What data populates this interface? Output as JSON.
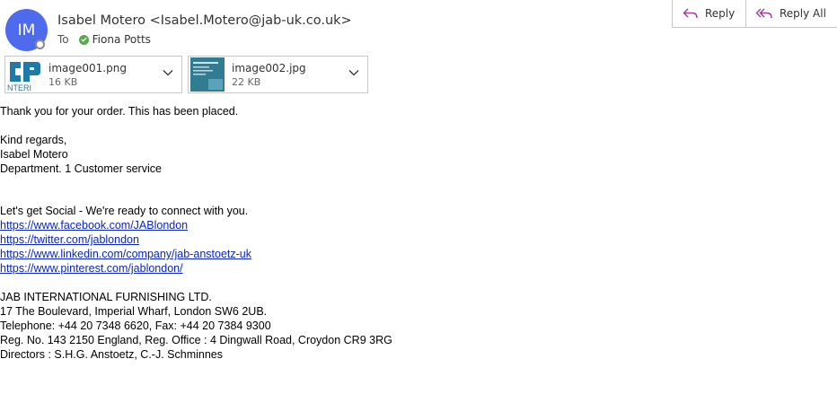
{
  "header": {
    "avatar_initials": "IM",
    "sender": "Isabel Motero <Isabel.Motero@jab-uk.co.uk>",
    "to_label": "To",
    "recipient": "Fiona Potts"
  },
  "actions": {
    "reply": "Reply",
    "reply_all": "Reply All"
  },
  "attachments": [
    {
      "name": "image001.png",
      "size": "16 KB",
      "thumb_text": "NTERI"
    },
    {
      "name": "image002.jpg",
      "size": "22 KB"
    }
  ],
  "message": {
    "line1": "Thank you for your order. This has been placed.",
    "regards": "Kind regards,",
    "name": "Isabel Motero",
    "dept": "Department. 1 Customer service",
    "social": "Let's get Social - We're ready to connect with you.",
    "links": [
      "https://www.facebook.com/JABlondon",
      "https://twitter.com/jablondon",
      "https://www.linkedin.com/company/jab-anstoetz-uk",
      "https://www.pinterest.com/jablondon/"
    ],
    "company": "JAB INTERNATIONAL FURNISHING LTD.",
    "address": "17 The Boulevard, Imperial Wharf, London SW6 2UB.",
    "phone": "Telephone: +44 20 7348 6620, Fax: +44 20 7384 9300",
    "reg": "Reg. No. 143 2150 England, Reg. Office : 4 Dingwall Road, Croydon CR9 3RG",
    "directors": "Directors : S.H.G. Anstoetz, C.-J. Schminnes"
  },
  "colors": {
    "avatar": "#4f6bed",
    "link": "#0b25c9",
    "presence_ok": "#56a84f",
    "reply_icon": "#a43a9c"
  }
}
